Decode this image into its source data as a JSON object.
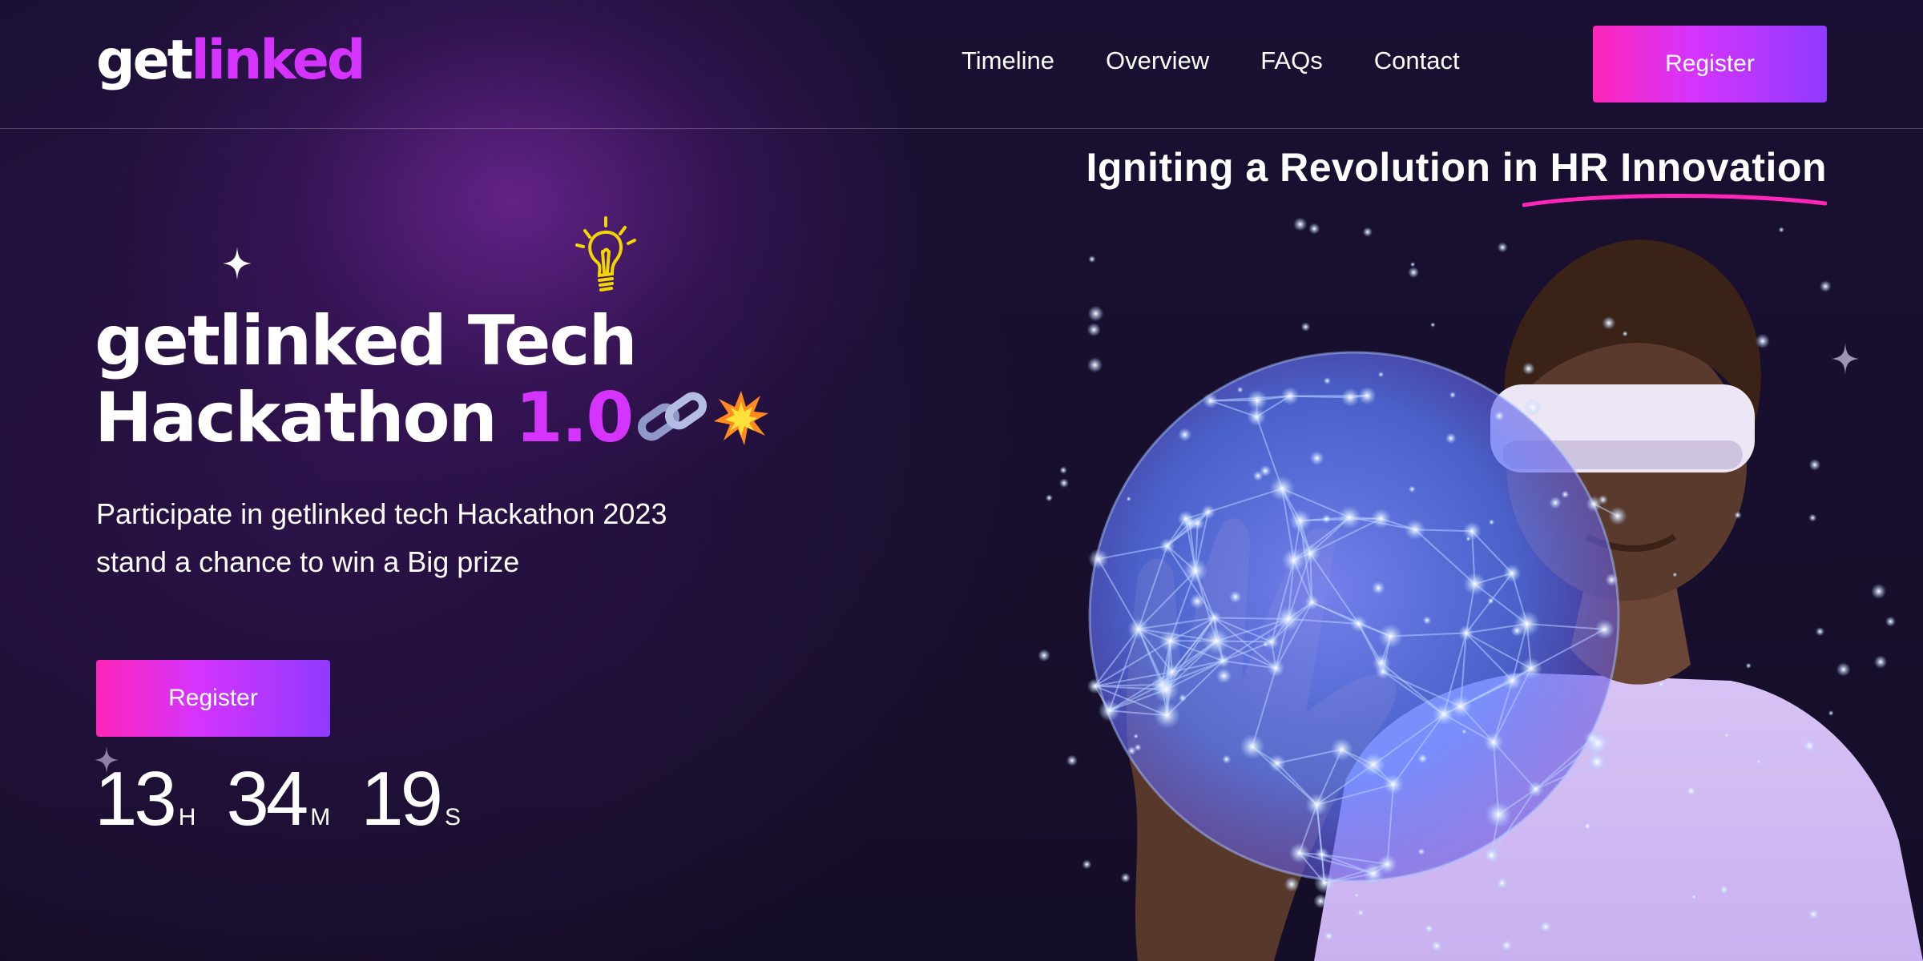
{
  "nav": {
    "logo_part1": "get",
    "logo_part2": "linked",
    "links": [
      "Timeline",
      "Overview",
      "FAQs",
      "Contact"
    ],
    "register_label": "Register"
  },
  "hero": {
    "tagline": "Igniting a Revolution in HR Innovation",
    "title_line1": "getlinked Tech",
    "title_line2_main": "Hackathon",
    "title_line2_accent": "1.0",
    "description": "Participate in getlinked tech Hackathon 2023 stand a chance to win a Big prize",
    "register_label": "Register",
    "countdown": {
      "hours": "13",
      "hours_unit": "H",
      "minutes": "34",
      "minutes_unit": "M",
      "seconds": "19",
      "seconds_unit": "S"
    },
    "icons": [
      "sparkle-icon",
      "lightbulb-icon",
      "chain-link-icon",
      "explosion-icon"
    ]
  },
  "colors": {
    "background": "#150e28",
    "accent": "#d434fe",
    "gradient_start": "#ff26b9",
    "gradient_end": "#903aff",
    "bulb": "#f2d600"
  }
}
